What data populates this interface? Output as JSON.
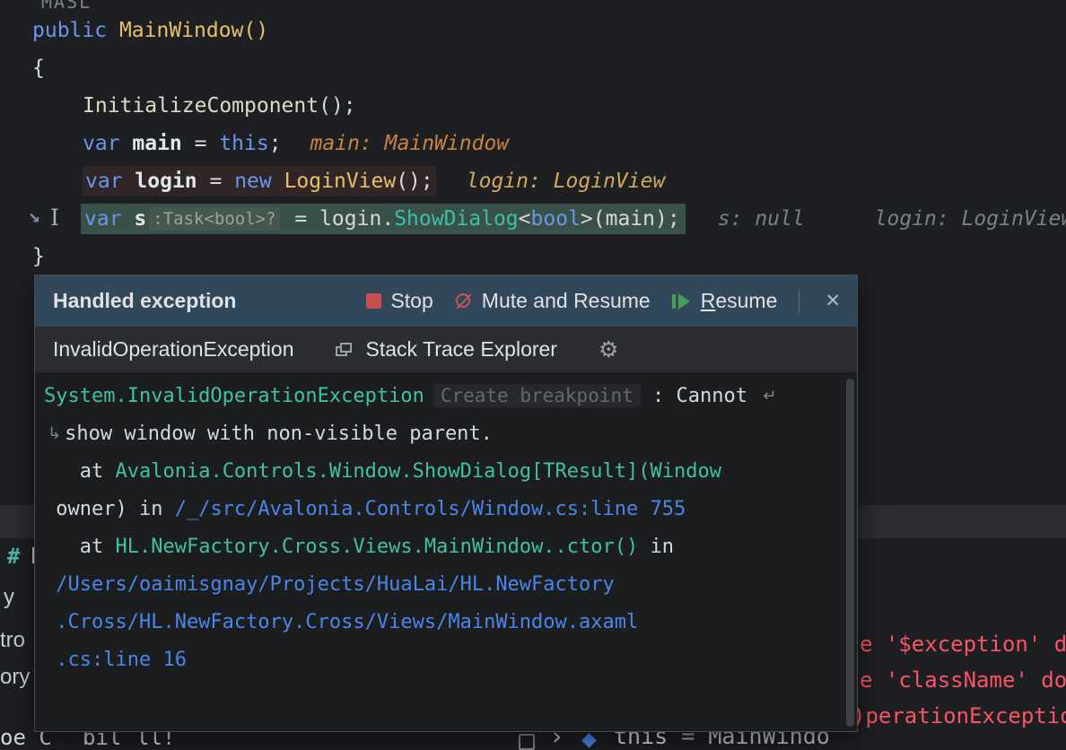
{
  "top_fragment": "MASL",
  "icons": {
    "gear": "⚙",
    "close": "✕",
    "chevron": "›",
    "cube": "◆",
    "exec_arrow": "→",
    "ibeam": "I",
    "wrap_end": "↵",
    "wrap_start": "↳"
  },
  "code": {
    "l1": {
      "kw": "public ",
      "method": "MainWindow()"
    },
    "l2": "{",
    "l3": {
      "call": "InitializeComponent",
      "rest": "();"
    },
    "l4": {
      "kw": "var ",
      "name": "main",
      "eq": " = ",
      "this_kw": "this",
      "semi": ";",
      "hint": "main: MainWindow"
    },
    "l5": {
      "kw": "var ",
      "name": "login",
      "eq": " = ",
      "new_kw": "new ",
      "type": "LoginView",
      "rest": "();",
      "hint": "login: LoginView"
    },
    "l6": {
      "kw": "var ",
      "name": "s",
      "type_hint": ":Task<bool>?",
      "eq": " = ",
      "obj": "login",
      "dot": ".",
      "method": "ShowDialog",
      "gen_open": "<",
      "gen_type": "bool",
      "gen_close": ">(",
      "arg": "main",
      "rest": ");",
      "hint1": "s: null",
      "hint2": "login: LoginView"
    },
    "l7": "}"
  },
  "popup": {
    "title": "Handled exception",
    "stop_label": "Stop",
    "mute_label": "Mute and Resume",
    "resume_mnemonic": "R",
    "resume_rest": "esume",
    "subheader": {
      "exception": "InvalidOperationException",
      "explorer": "Stack Trace Explorer"
    },
    "body": {
      "l1_type": "System.InvalidOperationException",
      "l1_ghost": "Create breakpoint",
      "l1_rest": " : Cannot ",
      "l2": "show window with non-visible parent.",
      "l3_pre": "   at ",
      "l3_sig": "Avalonia.Controls.Window.ShowDialog[TResult](Window",
      "l4_pre": " owner) in ",
      "l4_link": "/_/src/Avalonia.Controls/Window.cs:line 755",
      "l5_pre": "   at ",
      "l5_sig": "HL.NewFactory.Cross.Views.MainWindow..ctor()",
      "l5_post": " in",
      "l6_link": " /Users/oaimisgnay/Projects/HuaLai/HL.NewFactory",
      "l7_link": " .Cross/HL.NewFactory.Cross/Views/MainWindow.axaml",
      "l8_link": " .cs:line 16"
    }
  },
  "background": {
    "hash": "#",
    "h_label": "H",
    "frag_y": "y",
    "frag_tro": "tro",
    "frag_ory": "ory",
    "err1": "e '$exception' doe",
    "err2": "e 'className' doe",
    "err3": ")perationException",
    "bottom": {
      "f1": "oe C",
      "f2": "bil",
      "f3": "ll!",
      "this_label": "this",
      "eq": " = ",
      "value": "MainWindo"
    }
  }
}
